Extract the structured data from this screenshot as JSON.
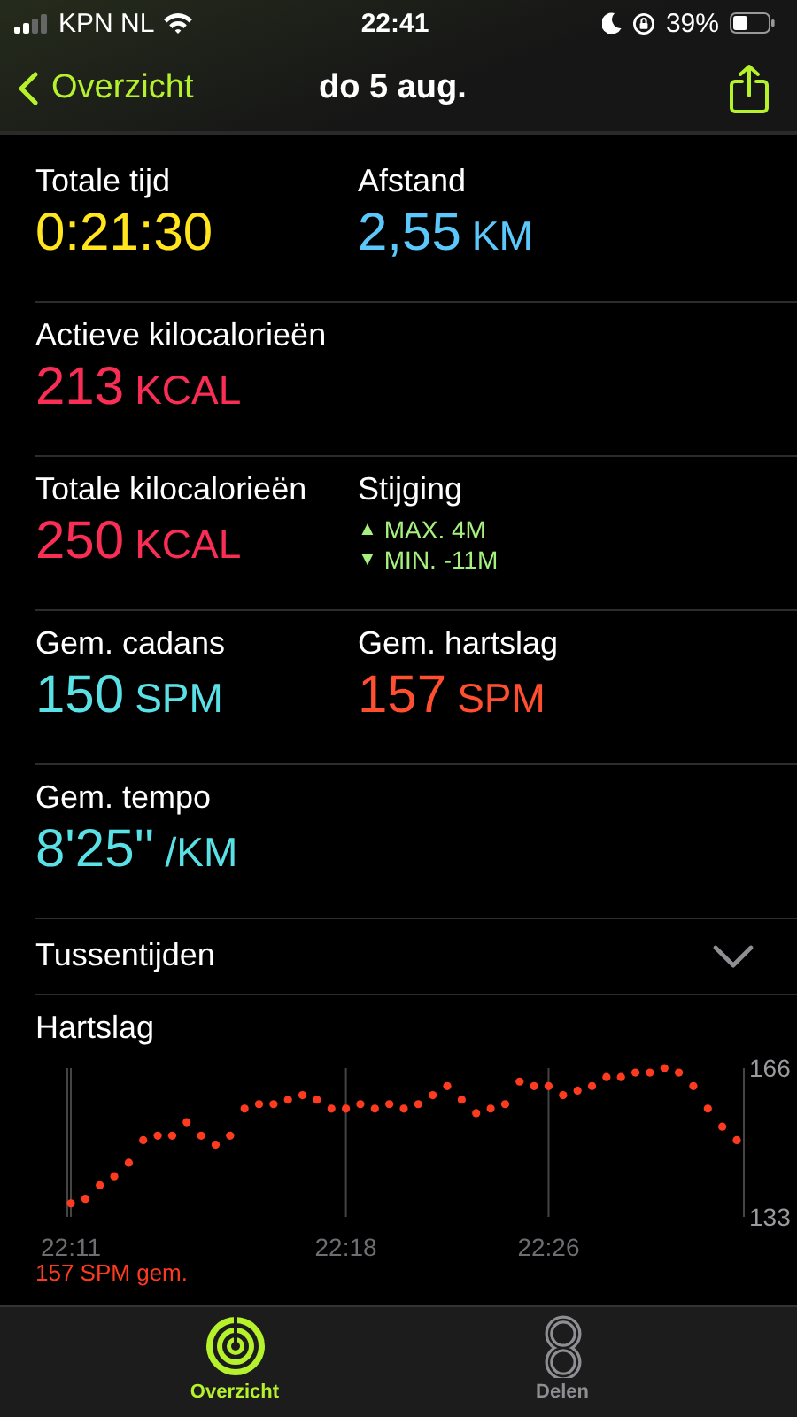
{
  "status_bar": {
    "carrier": "KPN NL",
    "time": "22:41",
    "battery": "39%"
  },
  "nav": {
    "back": "Overzicht",
    "title": "do 5 aug."
  },
  "metric_rows": [
    {
      "cells": [
        {
          "kind": "value",
          "label": "Totale tijd",
          "value": "0:21:30",
          "color": "#ffe41e"
        },
        {
          "kind": "value",
          "label": "Afstand",
          "value": "2,55",
          "unit": "KM",
          "color": "#5ac8fa"
        }
      ]
    },
    {
      "cells": [
        {
          "kind": "value",
          "label": "Actieve kilocalorieën",
          "value": "213",
          "unit": "KCAL",
          "color": "#fa2d55"
        }
      ]
    },
    {
      "cells": [
        {
          "kind": "value",
          "label": "Totale kilocalorieën",
          "value": "250",
          "unit": "KCAL",
          "color": "#fa2d55"
        },
        {
          "kind": "elevation",
          "label": "Stijging",
          "color": "#a6f07e",
          "lines": [
            {
              "arrow": "▲",
              "text": "MAX. 4M"
            },
            {
              "arrow": "▼",
              "text": "MIN. -11M"
            }
          ]
        }
      ]
    },
    {
      "cells": [
        {
          "kind": "value",
          "label": "Gem. cadans",
          "value": "150",
          "unit": "SPM",
          "color": "#5ae1e6"
        },
        {
          "kind": "value",
          "label": "Gem. hartslag",
          "value": "157",
          "unit": "SPM",
          "color": "#ff4f2e"
        }
      ]
    },
    {
      "cells": [
        {
          "kind": "value",
          "label": "Gem. tempo",
          "value": "8'25''",
          "unit": "/KM",
          "color": "#5ae1e6"
        }
      ]
    }
  ],
  "splits": {
    "label": "Tussentijden",
    "expanded": false
  },
  "heart_rate": {
    "average": "157 SPM gem.",
    "chart_data": {
      "type": "scatter",
      "title": "Hartslag",
      "grid": true,
      "ylim": [
        133,
        166
      ],
      "categories": [
        "22:11",
        null,
        null,
        null,
        null,
        null,
        null,
        null,
        null,
        null,
        null,
        null,
        null,
        null,
        null,
        null,
        null,
        null,
        null,
        "22:18",
        null,
        null,
        null,
        null,
        null,
        null,
        null,
        null,
        null,
        null,
        null,
        null,
        null,
        "22:26",
        null,
        null,
        null,
        null,
        null,
        null,
        null,
        null,
        null,
        null,
        null,
        null,
        null
      ],
      "yticks": [
        166,
        133
      ],
      "series": [
        {
          "color": "#ff3b1f",
          "values": [
            136,
            137,
            140,
            142,
            145,
            150,
            151,
            151,
            154,
            151,
            149,
            151,
            157,
            158,
            158,
            159,
            160,
            159,
            157,
            157,
            158,
            157,
            158,
            157,
            158,
            160,
            162,
            159,
            156,
            157,
            158,
            163,
            162,
            162,
            160,
            161,
            162,
            164,
            164,
            165,
            165,
            166,
            165,
            162,
            157,
            153,
            150
          ]
        }
      ]
    }
  },
  "tabs": [
    {
      "label": "Overzicht",
      "selected": true
    },
    {
      "label": "Delen",
      "selected": false
    }
  ]
}
